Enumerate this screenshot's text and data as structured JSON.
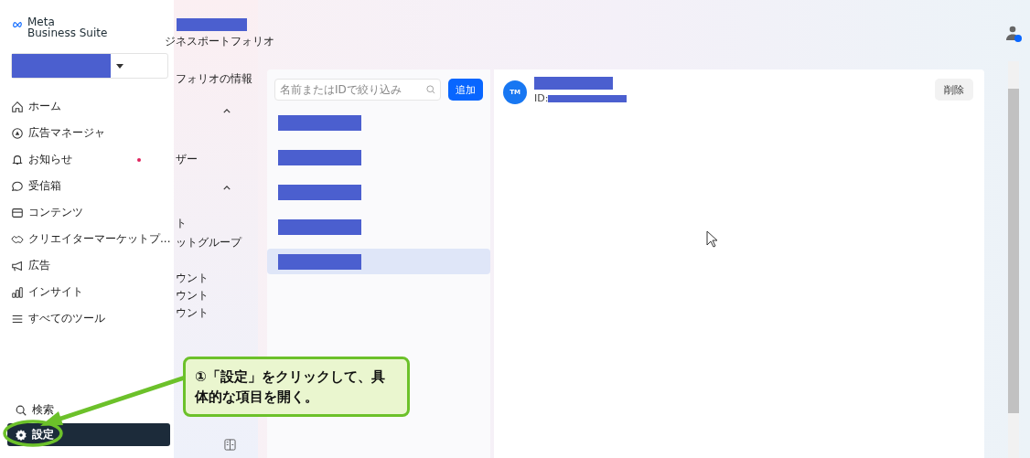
{
  "brand": {
    "line1": "Meta",
    "line2": "Business Suite"
  },
  "nav": [
    {
      "label": "ホーム",
      "selected": false,
      "dot": false
    },
    {
      "label": "広告マネージャ",
      "selected": false,
      "dot": false
    },
    {
      "label": "お知らせ",
      "selected": false,
      "dot": true
    },
    {
      "label": "受信箱",
      "selected": false,
      "dot": false
    },
    {
      "label": "コンテンツ",
      "selected": false,
      "dot": false
    },
    {
      "label": "クリエイターマーケットプ...",
      "selected": false,
      "dot": false
    },
    {
      "label": "広告",
      "selected": false,
      "dot": false
    },
    {
      "label": "インサイト",
      "selected": false,
      "dot": false
    },
    {
      "label": "すべてのツール",
      "selected": false,
      "dot": false
    }
  ],
  "bottom_nav": [
    {
      "label": "検索",
      "selected": false
    },
    {
      "label": "設定",
      "selected": true
    }
  ],
  "settings_column": {
    "title": "ジネスポートフォリオ",
    "items": [
      {
        "kind": "text",
        "text": "フォリオの情報"
      },
      {
        "kind": "chevron"
      },
      {
        "kind": "text",
        "text": "ザー"
      },
      {
        "kind": "chevron"
      },
      {
        "kind": "text",
        "text": "ト"
      },
      {
        "kind": "text",
        "text": "ットグループ"
      },
      {
        "kind": "text",
        "text": "ウント"
      },
      {
        "kind": "text",
        "text": "ウント"
      },
      {
        "kind": "text",
        "text": "ウント"
      }
    ]
  },
  "list": {
    "search": {
      "placeholder": "名前またはIDで絞り込み"
    },
    "add_button": "追加",
    "rows": [
      {
        "selected": false
      },
      {
        "selected": false
      },
      {
        "selected": false
      },
      {
        "selected": false
      },
      {
        "selected": true
      }
    ]
  },
  "detail": {
    "avatar": "TM",
    "id_label": "ID:",
    "delete_button": "削除"
  },
  "callout": {
    "text": "①「設定」をクリックして、具体的な項目を開く。"
  }
}
